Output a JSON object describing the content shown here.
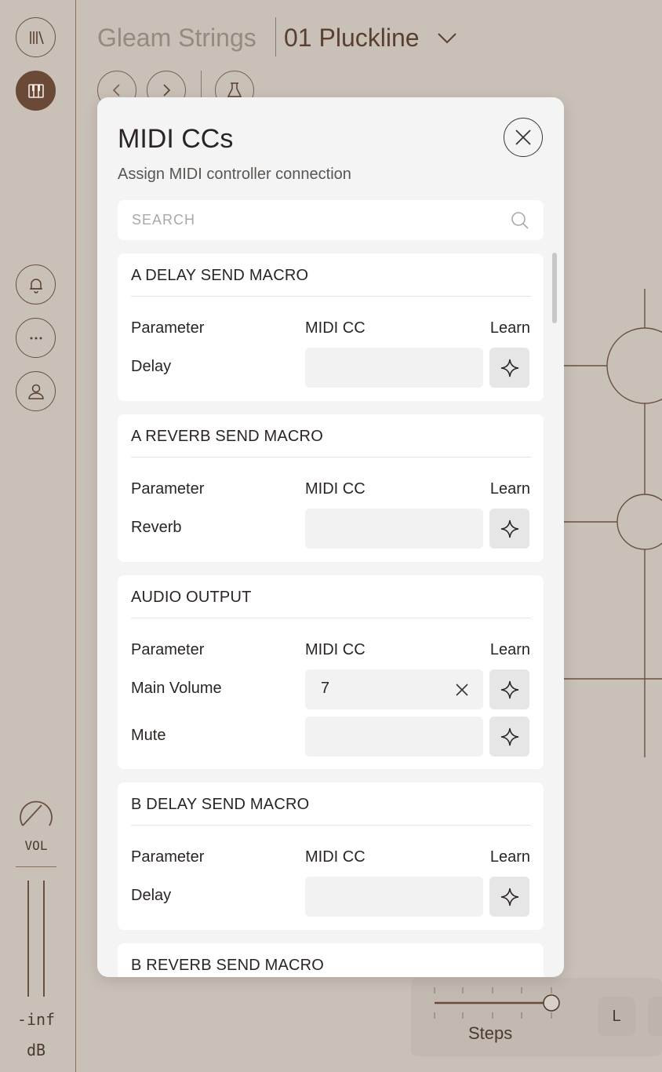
{
  "header": {
    "app_title": "Gleam Strings",
    "preset_name": "01 Pluckline"
  },
  "sidebar": {
    "vol_label": "VOL",
    "meter_value": "-inf",
    "meter_unit": "dB"
  },
  "bottom": {
    "steps_label": "Steps",
    "l_label": "L"
  },
  "modal": {
    "title": "MIDI CCs",
    "subtitle": "Assign MIDI controller connection",
    "search_placeholder": "SEARCH",
    "col_param": "Parameter",
    "col_cc": "MIDI CC",
    "col_learn": "Learn",
    "sections": [
      {
        "title": "A DELAY SEND MACRO",
        "rows": [
          {
            "parameter": "Delay",
            "cc": ""
          }
        ]
      },
      {
        "title": "A REVERB SEND MACRO",
        "rows": [
          {
            "parameter": "Reverb",
            "cc": ""
          }
        ]
      },
      {
        "title": "AUDIO OUTPUT",
        "rows": [
          {
            "parameter": "Main Volume",
            "cc": "7"
          },
          {
            "parameter": "Mute",
            "cc": ""
          }
        ]
      },
      {
        "title": "B DELAY SEND MACRO",
        "rows": [
          {
            "parameter": "Delay",
            "cc": ""
          }
        ]
      },
      {
        "title": "B REVERB SEND MACRO",
        "rows": []
      }
    ]
  }
}
